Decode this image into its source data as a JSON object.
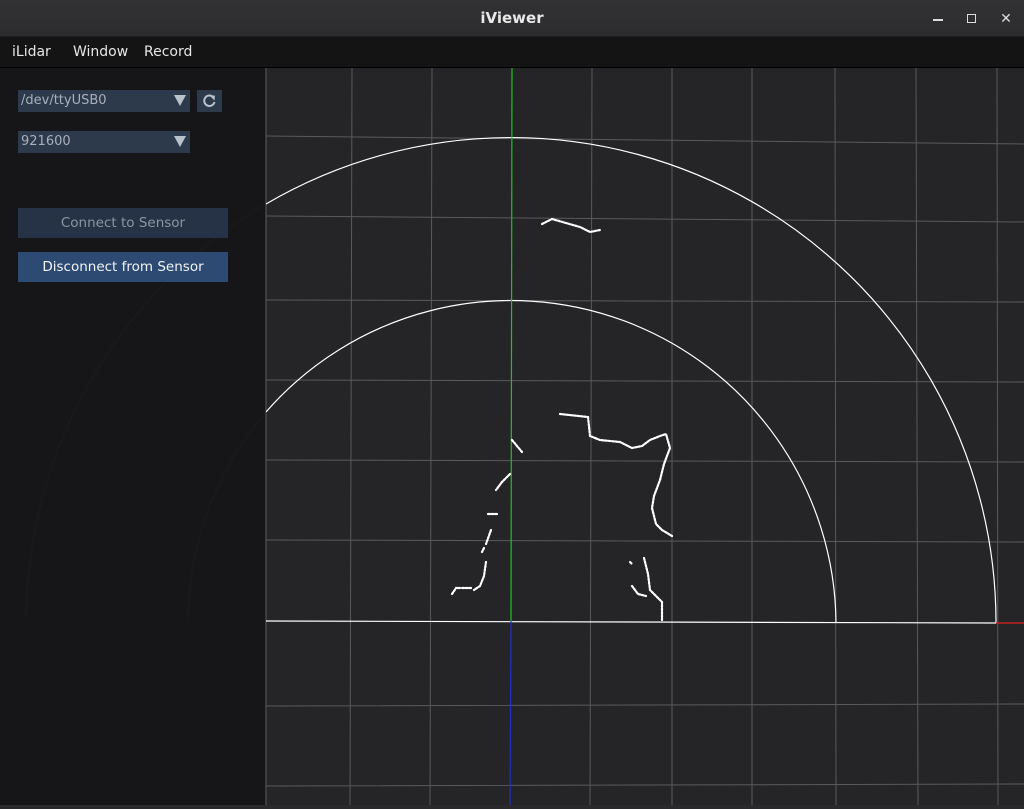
{
  "window": {
    "title": "iViewer",
    "minimize_icon": "minimize-icon",
    "maximize_icon": "maximize-icon",
    "close_icon": "close-icon"
  },
  "menubar": {
    "items": [
      {
        "label": "iLidar"
      },
      {
        "label": "Window"
      },
      {
        "label": "Record"
      }
    ]
  },
  "sidebar": {
    "port_select": {
      "value": "/dev/ttyUSB0"
    },
    "refresh_icon": "refresh-icon",
    "baud_select": {
      "value": "921600"
    },
    "connect_button": {
      "label": "Connect to Sensor",
      "state": "disabled"
    },
    "disconnect_button": {
      "label": "Disconnect from Sensor",
      "state": "enabled"
    }
  },
  "viewport": {
    "background": "#252528",
    "grid_color": "#5a5a5e",
    "ring_color": "#ffffff",
    "axis_colors": {
      "x": "#e02020",
      "y": "#20c020",
      "z": "#2030c0"
    },
    "point_color": "#ffffff"
  }
}
